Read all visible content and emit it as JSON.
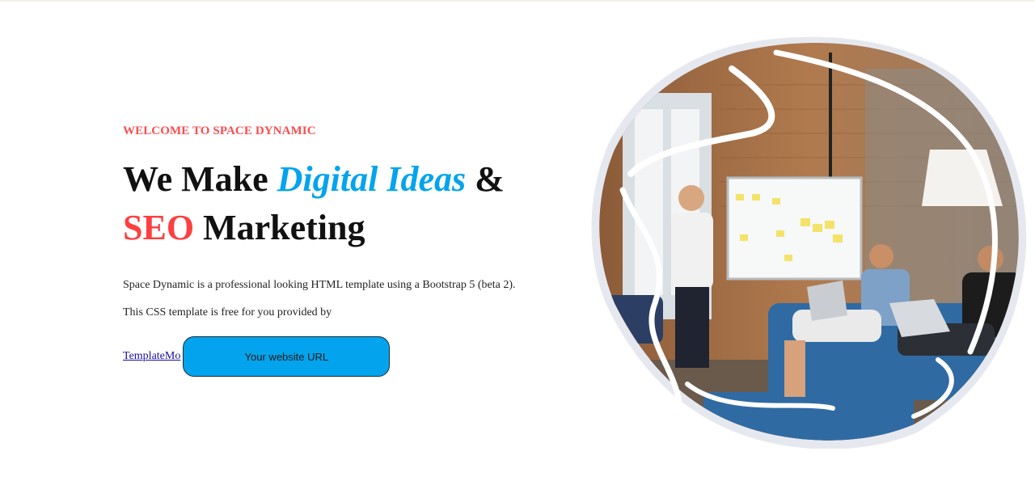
{
  "hero": {
    "eyebrow": "WELCOME TO SPACE DYNAMIC",
    "headline_part1": "We Make ",
    "headline_highlight1": "Digital Ideas",
    "headline_part2": " &",
    "headline_highlight2": "SEO",
    "headline_part3": " Marketing",
    "description": "Space Dynamic is a professional looking HTML template using a Bootstrap 5 (beta 2). This CSS template is free for you provided by",
    "link_text": "TemplateMo",
    "button_label": "Your website URL"
  },
  "colors": {
    "accent_blue": "#03a4ed",
    "accent_red": "#fe3f40",
    "eyebrow_red": "#fb4d4f"
  },
  "image": {
    "subject": "team-meeting-whiteboard-illustration"
  }
}
